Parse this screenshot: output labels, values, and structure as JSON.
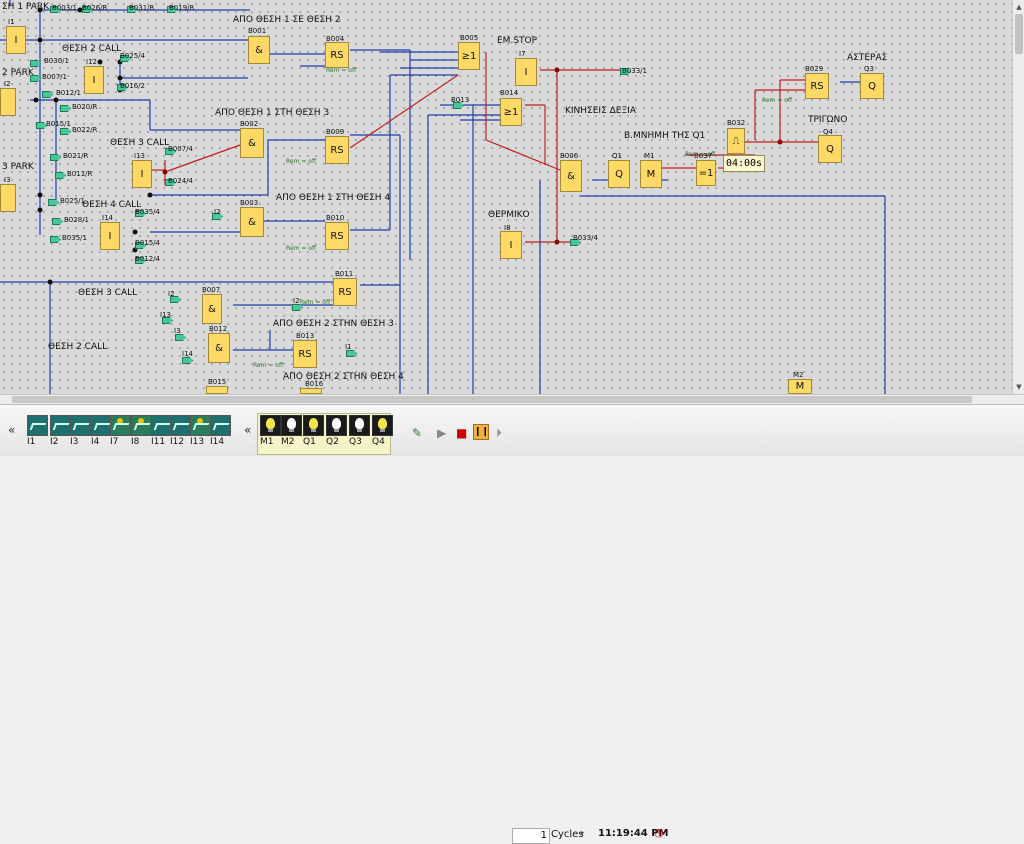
{
  "diagram": {
    "captions": [
      "ΣΗ 1 PARK",
      "ΘΕΣΗ 2 CALL",
      "2 PARK",
      "ΑΠΟ ΘΕΣΗ 1 ΣΕ ΘΕΣΗ 2",
      "ΑΠΟ ΘΕΣΗ 1 ΣΤΗ ΘΕΣΗ 3",
      "ΘΕΣΗ 3 CALL",
      "3 PARK",
      "ΘΕΣΗ 4 CALL",
      "ΑΠΟ ΘΕΣΗ 1 ΣΤΗ ΘΕΣΗ 4",
      "ΘΕΣΗ 3 CALL",
      "ΘΕΣΗ 2 CALL",
      "ΑΠΟ ΘΕΣΗ 2 ΣΤΗΝ ΘΕΣΗ 3",
      "ΑΠΟ ΘΕΣΗ 2 ΣΤΗΝ ΘΕΣΗ 4",
      "ΕΜ.STOP",
      "ΚΙΝΗΣΕΙΣ ΔΕΞΙΑ",
      "Β.ΜΝΗΜΗ ΤΗΣ Q1",
      "ΘΕΡΜΙΚΟ",
      "ΑΣΤΕΡΑΣ",
      "ΤΡΙΓΩΝΟ"
    ],
    "blocks": [
      {
        "id": "B001",
        "sym": "&"
      },
      {
        "id": "B004",
        "sym": "RS"
      },
      {
        "id": "B005",
        "sym": "≥1"
      },
      {
        "id": "B002",
        "sym": "&"
      },
      {
        "id": "B009",
        "sym": "RS"
      },
      {
        "id": "B003",
        "sym": "&"
      },
      {
        "id": "B010",
        "sym": "RS"
      },
      {
        "id": "B011",
        "sym": "RS"
      },
      {
        "id": "B007",
        "sym": "&"
      },
      {
        "id": "B012",
        "sym": "&"
      },
      {
        "id": "B013",
        "sym": "RS"
      },
      {
        "id": "B014",
        "sym": "≥1"
      },
      {
        "id": "B006",
        "sym": "&"
      },
      {
        "id": "B029",
        "sym": "RS"
      },
      {
        "id": "B032",
        "sym": "⎍"
      },
      {
        "id": "B037",
        "sym": "=1"
      },
      {
        "id": "B015",
        "sym": ""
      },
      {
        "id": "B016",
        "sym": ""
      }
    ],
    "inputs": [
      {
        "id": "I1",
        "sym": "I"
      },
      {
        "id": "I12",
        "sym": "I"
      },
      {
        "id": "I2",
        "sym": ""
      },
      {
        "id": "I13",
        "sym": "I"
      },
      {
        "id": "I3",
        "sym": ""
      },
      {
        "id": "I14",
        "sym": "I"
      },
      {
        "id": "I7",
        "sym": "I"
      },
      {
        "id": "I8",
        "sym": "I"
      }
    ],
    "outputs": [
      {
        "id": "Q1",
        "sym": "Q"
      },
      {
        "id": "M1",
        "sym": "M"
      },
      {
        "id": "Q3",
        "sym": "Q"
      },
      {
        "id": "Q4",
        "sym": "Q"
      },
      {
        "id": "M2",
        "sym": "M"
      }
    ],
    "connectors": [
      "B003/1",
      "B026/R",
      "B031/R",
      "B019/R",
      "B025/4",
      "B030/1",
      "B007/1",
      "B016/2",
      "B012/1",
      "B020/R",
      "B015/1",
      "B022/R",
      "B007/4",
      "B024/4",
      "B021/R",
      "B011/R",
      "B025/1",
      "B028/1",
      "B035/4",
      "B035/1",
      "B015/4",
      "B012/4",
      "B033/1",
      "B033/4",
      "B013",
      "I2",
      "I13",
      "I2",
      "I14",
      "I3",
      "I2",
      "I1",
      "Q4",
      "I3"
    ],
    "rem_label": "Rem = off",
    "timer_value": "04:00s"
  },
  "toolbar": {
    "inputs": [
      "I1",
      "I2",
      "I3",
      "I4",
      "I7",
      "I8",
      "I11",
      "I12",
      "I13",
      "I14"
    ],
    "active_inputs": [
      "I7",
      "I8",
      "I13"
    ],
    "outputs": [
      "M1",
      "M2",
      "Q1",
      "Q2",
      "Q3",
      "Q4"
    ],
    "outputs_on": [
      "M1",
      "Q1",
      "Q4"
    ],
    "cycles_value": "1",
    "cycles_label": "Cycles",
    "clock": "11:19:44 PM"
  },
  "colors": {
    "block": "#ffd966",
    "connector": "#47c79a",
    "wire_blue": "#1f3fa8",
    "wire_red": "#c02020"
  }
}
